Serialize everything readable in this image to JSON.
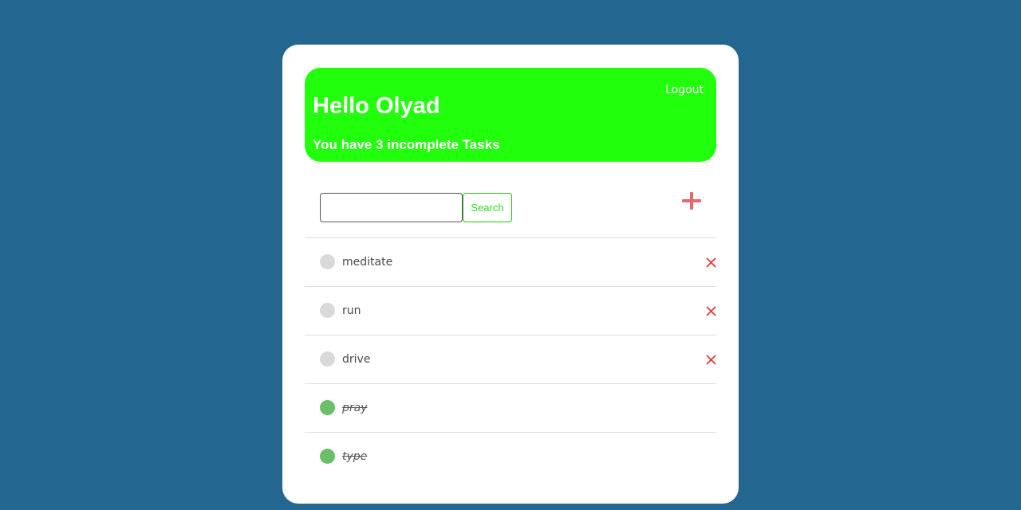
{
  "header": {
    "greeting": "Hello Olyad",
    "summary": "You have 3 incomplete Tasks",
    "logout_label": "Logout"
  },
  "search": {
    "value": "",
    "placeholder": "",
    "button_label": "Search"
  },
  "add_button": {
    "icon": "plus-icon"
  },
  "tasks": [
    {
      "label": "meditate",
      "completed": false
    },
    {
      "label": "run",
      "completed": false
    },
    {
      "label": "drive",
      "completed": false
    },
    {
      "label": "pray",
      "completed": true
    },
    {
      "label": "type",
      "completed": true
    }
  ],
  "colors": {
    "page_background": "#23668f",
    "banner": "#22ff0d",
    "accent_green": "#33d61f",
    "done_check": "#6abf69",
    "pending_check": "#d9d9d9",
    "delete_red": "#e03c3c",
    "add_red": "#e26a6a"
  }
}
